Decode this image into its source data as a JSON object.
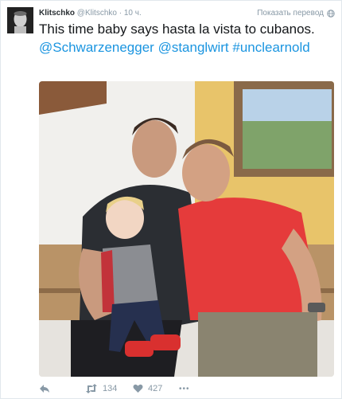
{
  "user": {
    "name": "Klitschko",
    "handle": "@Klitschko",
    "separator": "·",
    "time": "10 ч."
  },
  "translate_label": "Показать перевод",
  "tweet": {
    "text_plain": "This time baby says hasta la vista to cubanos. ",
    "mention1": "@Schwarzenegger",
    "mention2": "@stanglwirt",
    "hashtag": "#unclearnold"
  },
  "actions": {
    "retweets": "134",
    "likes": "427",
    "more": "•••"
  },
  "icons": [
    "reply-icon",
    "retweet-icon",
    "heart-icon",
    "more-icon",
    "globe-icon"
  ],
  "colors": {
    "link": "#1b95e0",
    "meta": "#8899a6",
    "text": "#14171a"
  }
}
